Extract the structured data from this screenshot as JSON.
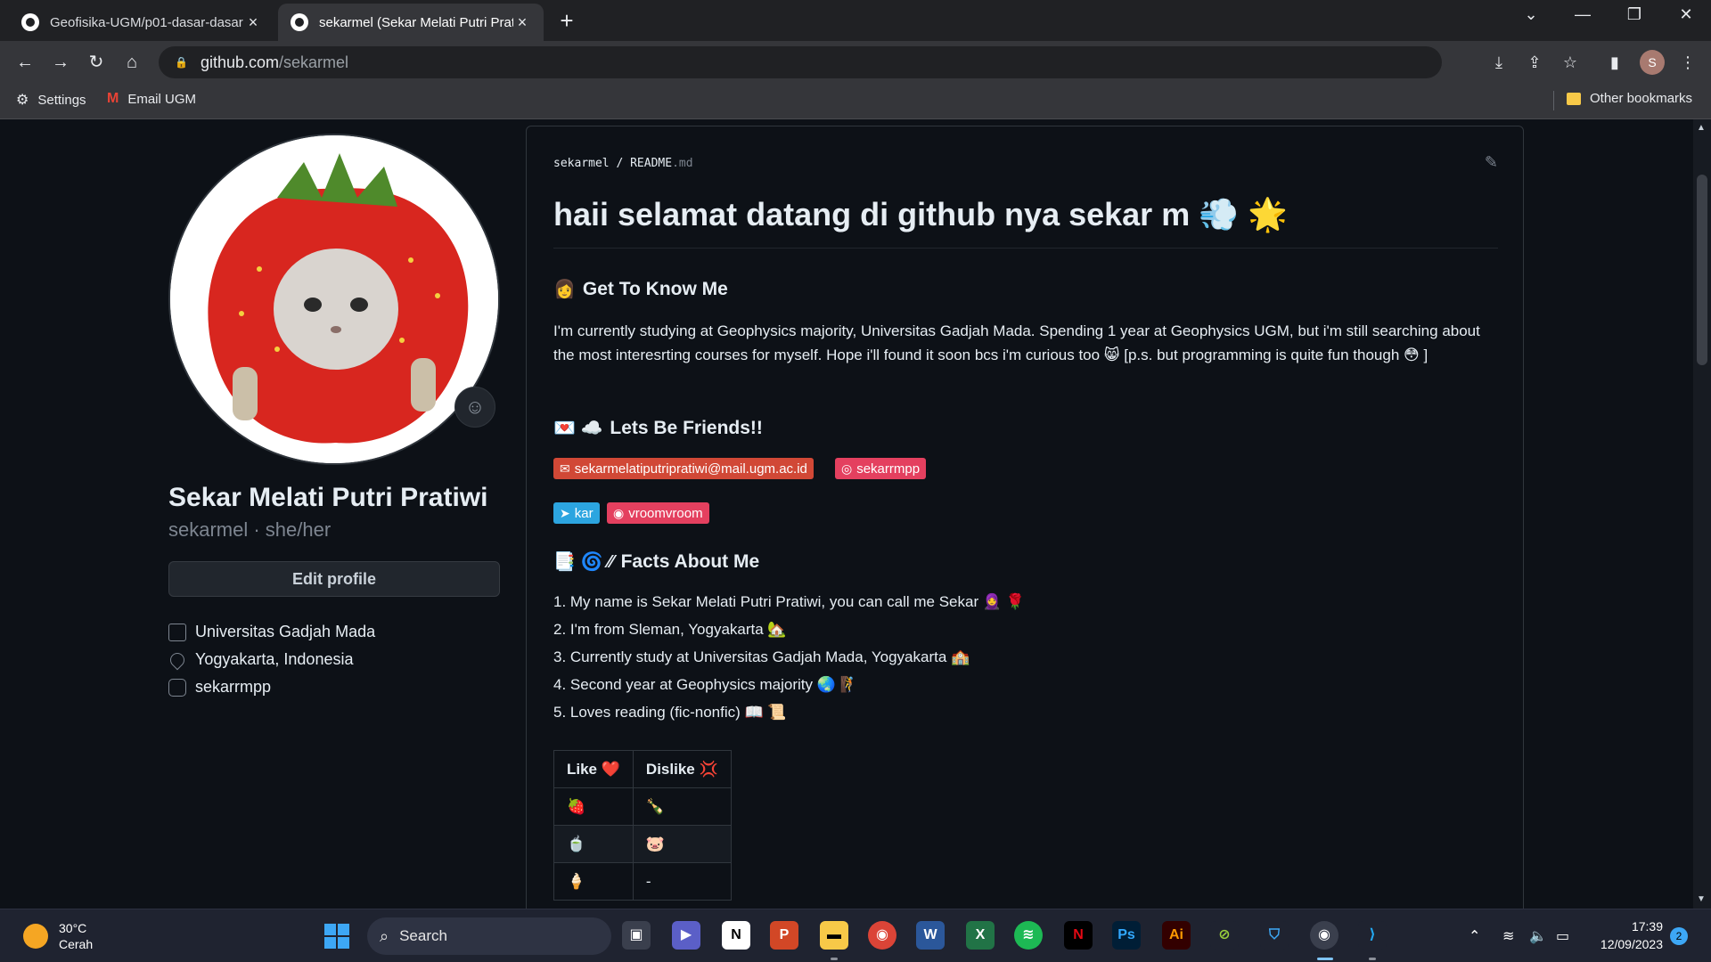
{
  "browser": {
    "tabs": [
      {
        "title": "Geofisika-UGM/p01-dasar-dasar"
      },
      {
        "title": "sekarmel (Sekar Melati Putri Prati"
      }
    ],
    "url_host": "github.com",
    "url_path": "/sekarmel",
    "profile_initial": "S",
    "bookmarks": {
      "settings": "Settings",
      "email": "Email UGM",
      "other": "Other bookmarks"
    }
  },
  "profile": {
    "name": "Sekar Melati Putri Pratiwi",
    "sub": "sekarmel · she/her",
    "edit_button": "Edit profile",
    "organization": "Universitas Gadjah Mada",
    "location": "Yogyakarta, Indonesia",
    "instagram": "sekarrmpp"
  },
  "readme": {
    "path_user": "sekarmel",
    "path_sep": " / ",
    "path_file": "README",
    "path_ext": ".md",
    "title": "haii selamat datang di github nya sekar m 💨 🌟",
    "section1": {
      "emoji": "👩",
      "title": "Get To Know Me"
    },
    "paragraph": "I'm currently studying at Geophysics majority, Universitas Gadjah Mada. Spending 1 year at Geophysics UGM, but i'm still searching about the most interesrting courses for myself. Hope i'll found it soon bcs i'm curious too 😸 [p.s. but programming is quite fun though 😳 ]",
    "section2": {
      "emoji": "💌 ☁️",
      "title": "Lets Be Friends!!"
    },
    "badges": {
      "email": "sekarmelatiputripratiwi@mail.ugm.ac.id",
      "instagram": "sekarrmpp",
      "telegram": "kar",
      "spotify": "vroomvroom"
    },
    "section3": {
      "emoji": "📑 🌀 ⁄⁄",
      "title": "Facts About Me"
    },
    "facts": [
      "1. My name is Sekar Melati Putri Pratiwi, you can call me Sekar 🧕 🌹",
      "2. I'm from Sleman, Yogyakarta 🏡",
      "3. Currently study at Universitas Gadjah Mada, Yogyakarta 🏫",
      "4. Second year at Geophysics majority 🌏 🧗",
      "5. Loves reading (fic-nonfic) 📖 📜"
    ],
    "table": {
      "headers": [
        "Like ❤️",
        "Dislike 💢"
      ],
      "rows": [
        [
          "🍓",
          "🍾"
        ],
        [
          "🍵",
          "🐷"
        ],
        [
          "🍦",
          "-"
        ]
      ]
    }
  },
  "taskbar": {
    "temp": "30°C",
    "weather": "Cerah",
    "search": "Search",
    "time": "17:39",
    "date": "12/09/2023",
    "notifications": "2"
  },
  "colors": {
    "gmail_badge": "#d14836",
    "instagram_badge": "#e4405f",
    "telegram_badge": "#2ca5e0",
    "spotify_badge": "#e4405f"
  }
}
